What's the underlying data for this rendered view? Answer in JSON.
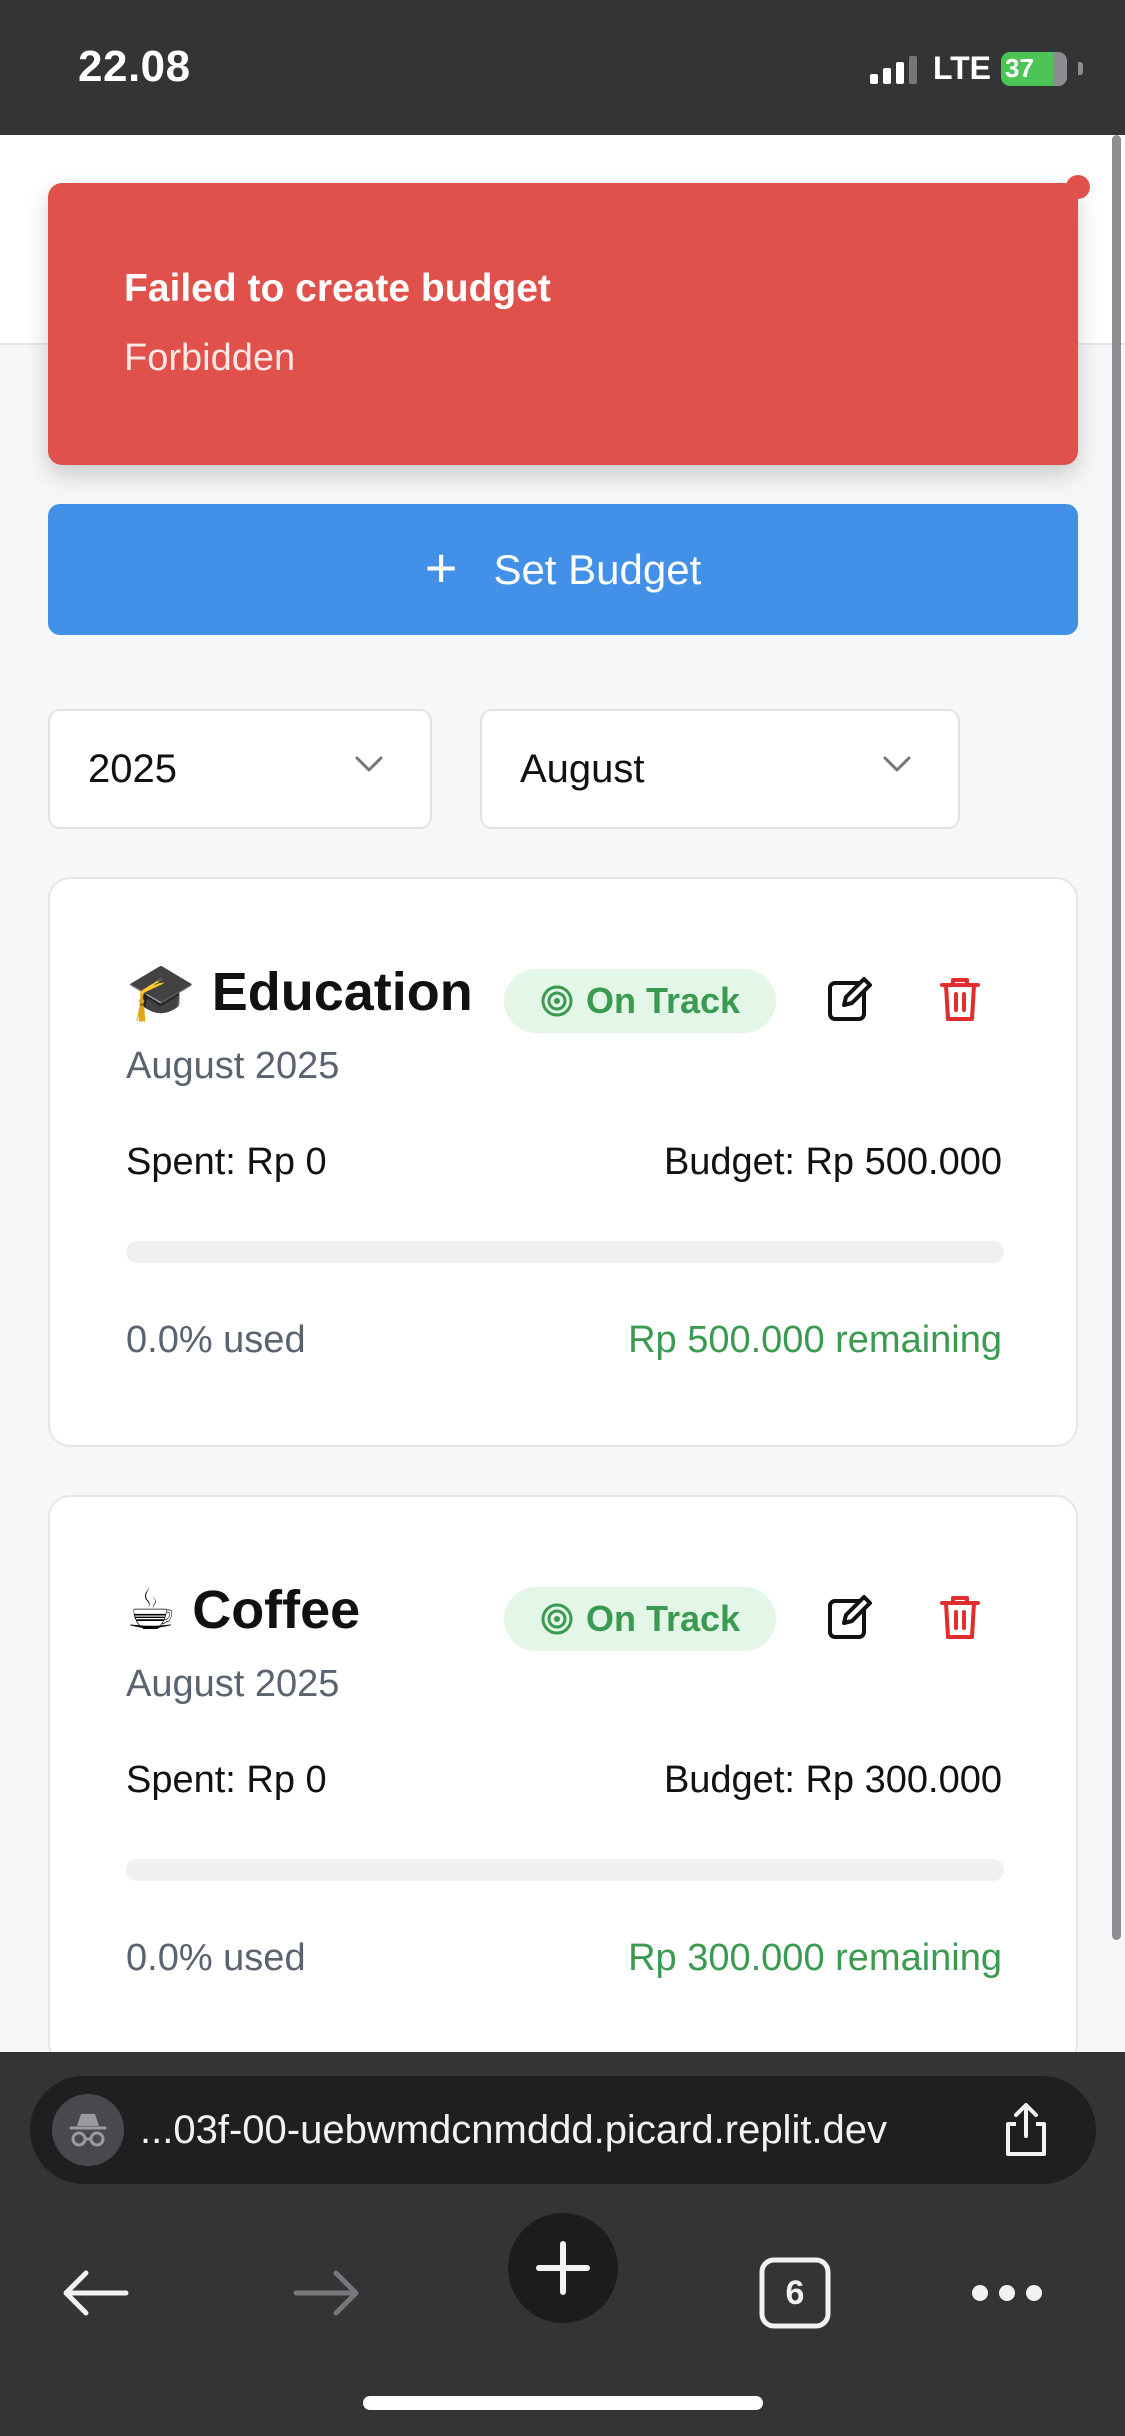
{
  "status_bar": {
    "time": "22.08",
    "network": "LTE",
    "battery": "37"
  },
  "toast": {
    "title": "Failed to create budget",
    "message": "Forbidden",
    "color": "#e0514b"
  },
  "actions": {
    "set_budget_label": "Set Budget",
    "accent": "#4390e8"
  },
  "filters": {
    "year": "2025",
    "month": "August"
  },
  "budgets": [
    {
      "emoji": "🎓",
      "category": "Education",
      "status": "On Track",
      "period": "August 2025",
      "spent": "Spent: Rp 0",
      "budget": "Budget: Rp 500.000",
      "progress": 0,
      "used": "0.0% used",
      "remaining": "Rp 500.000 remaining"
    },
    {
      "emoji": "☕",
      "category": "Coffee",
      "status": "On Track",
      "period": "August 2025",
      "spent": "Spent: Rp 0",
      "budget": "Budget: Rp 300.000",
      "progress": 0,
      "used": "0.0% used",
      "remaining": "Rp 300.000 remaining"
    }
  ],
  "browser": {
    "url": "...03f-00-uebwmdcnmddd.picard.replit.dev",
    "tab_count": "6"
  },
  "icons": [
    "incognito-icon",
    "share-icon",
    "back-arrow-icon",
    "forward-arrow-icon",
    "plus-icon",
    "tabs-icon",
    "more-icon",
    "target-icon",
    "edit-icon",
    "trash-icon",
    "chevron-down-icon"
  ]
}
